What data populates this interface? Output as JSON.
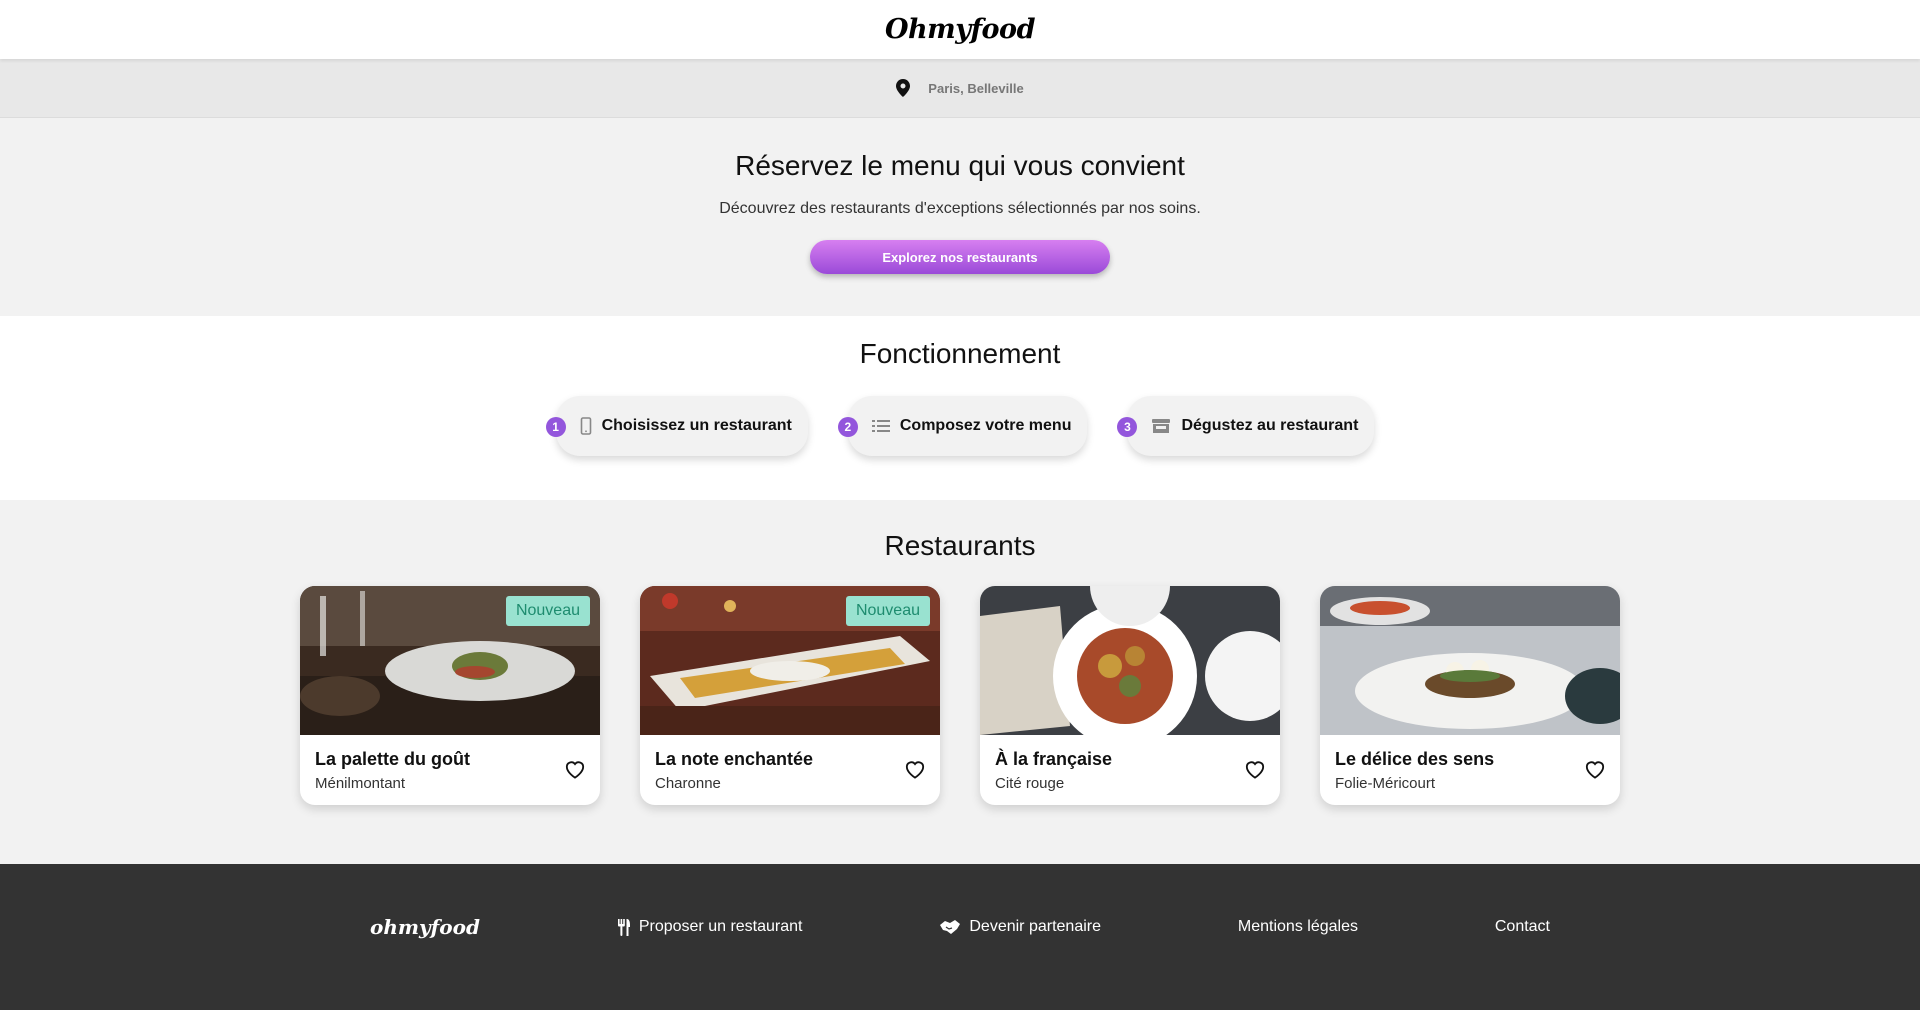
{
  "header": {
    "logo": "Ohmyfood"
  },
  "location": {
    "text": "Paris, Belleville",
    "icon": "map-pin-icon"
  },
  "hero": {
    "title": "Réservez le menu qui vous convient",
    "subtitle": "Découvrez des restaurants d'exceptions sélectionnés par nos soins.",
    "cta_label": "Explorez nos restaurants"
  },
  "how": {
    "title": "Fonctionnement",
    "steps": [
      {
        "number": "1",
        "label": "Choisissez un restaurant",
        "icon": "mobile-phone-icon"
      },
      {
        "number": "2",
        "label": "Composez votre menu",
        "icon": "list-icon"
      },
      {
        "number": "3",
        "label": "Dégustez au restaurant",
        "icon": "store-icon"
      }
    ]
  },
  "restaurants": {
    "title": "Restaurants",
    "items": [
      {
        "name": "La palette du goût",
        "area": "Ménilmontant",
        "badge": "Nouveau"
      },
      {
        "name": "La note enchantée",
        "area": "Charonne",
        "badge": "Nouveau"
      },
      {
        "name": "À la française",
        "area": "Cité rouge",
        "badge": ""
      },
      {
        "name": "Le délice des sens",
        "area": "Folie-Méricourt",
        "badge": ""
      }
    ]
  },
  "footer": {
    "logo": "ohmyfood",
    "links": [
      {
        "label": "Proposer un restaurant",
        "icon": "utensils-icon"
      },
      {
        "label": "Devenir partenaire",
        "icon": "handshake-icon"
      },
      {
        "label": "Mentions légales",
        "icon": ""
      },
      {
        "label": "Contact",
        "icon": ""
      }
    ]
  },
  "colors": {
    "accent_purple": "#9356dc",
    "badge_bg": "#99e2d0",
    "badge_text": "#1e8c6f",
    "footer_bg": "#333333"
  }
}
